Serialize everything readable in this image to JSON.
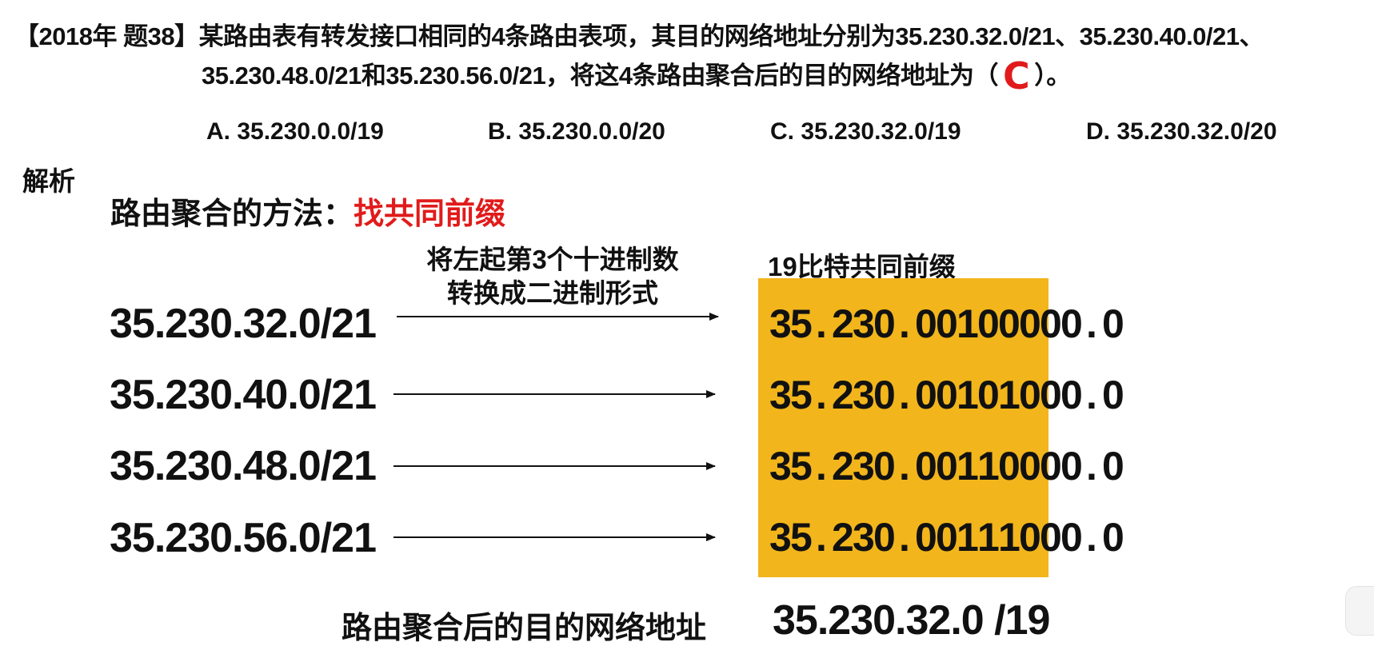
{
  "question": {
    "prefix": "【2018年 题38】",
    "line1_text": "某路由表有转发接口相同的4条路由表项，其目的网络地址分别为35.230.32.0/21、35.230.40.0/21、",
    "line2_text": "35.230.48.0/21和35.230.56.0/21，将这4条路由聚合后的目的网络地址为（",
    "answer": "C",
    "line2_end": "）。"
  },
  "options": [
    {
      "label": "A. 35.230.0.0/19"
    },
    {
      "label": "B. 35.230.0.0/20"
    },
    {
      "label": "C. 35.230.32.0/19"
    },
    {
      "label": "D. 35.230.32.0/20"
    }
  ],
  "analysis": {
    "heading": "解析",
    "method_label": "路由聚合的方法：",
    "method_highlight": "找共同前缀",
    "arrow_caption_line1": "将左起第3个十进制数",
    "arrow_caption_line2": "转换成二进制形式",
    "prefix_caption": "19比特共同前缀"
  },
  "routes": [
    {
      "decimal": "35.230.32.0/21",
      "prefix": "35.230.001",
      "suffix": "00000.0"
    },
    {
      "decimal": "35.230.40.0/21",
      "prefix": "35.230.001",
      "suffix": "01000.0"
    },
    {
      "decimal": "35.230.48.0/21",
      "prefix": "35.230.001",
      "suffix": "10000.0"
    },
    {
      "decimal": "35.230.56.0/21",
      "prefix": "35.230.001",
      "suffix": "11000.0"
    }
  ],
  "result": {
    "label": "路由聚合后的目的网络地址",
    "value": "35.230.32.0 /19"
  },
  "colors": {
    "highlight_red": "#e11b1b",
    "prefix_box": "#f2b51b"
  }
}
